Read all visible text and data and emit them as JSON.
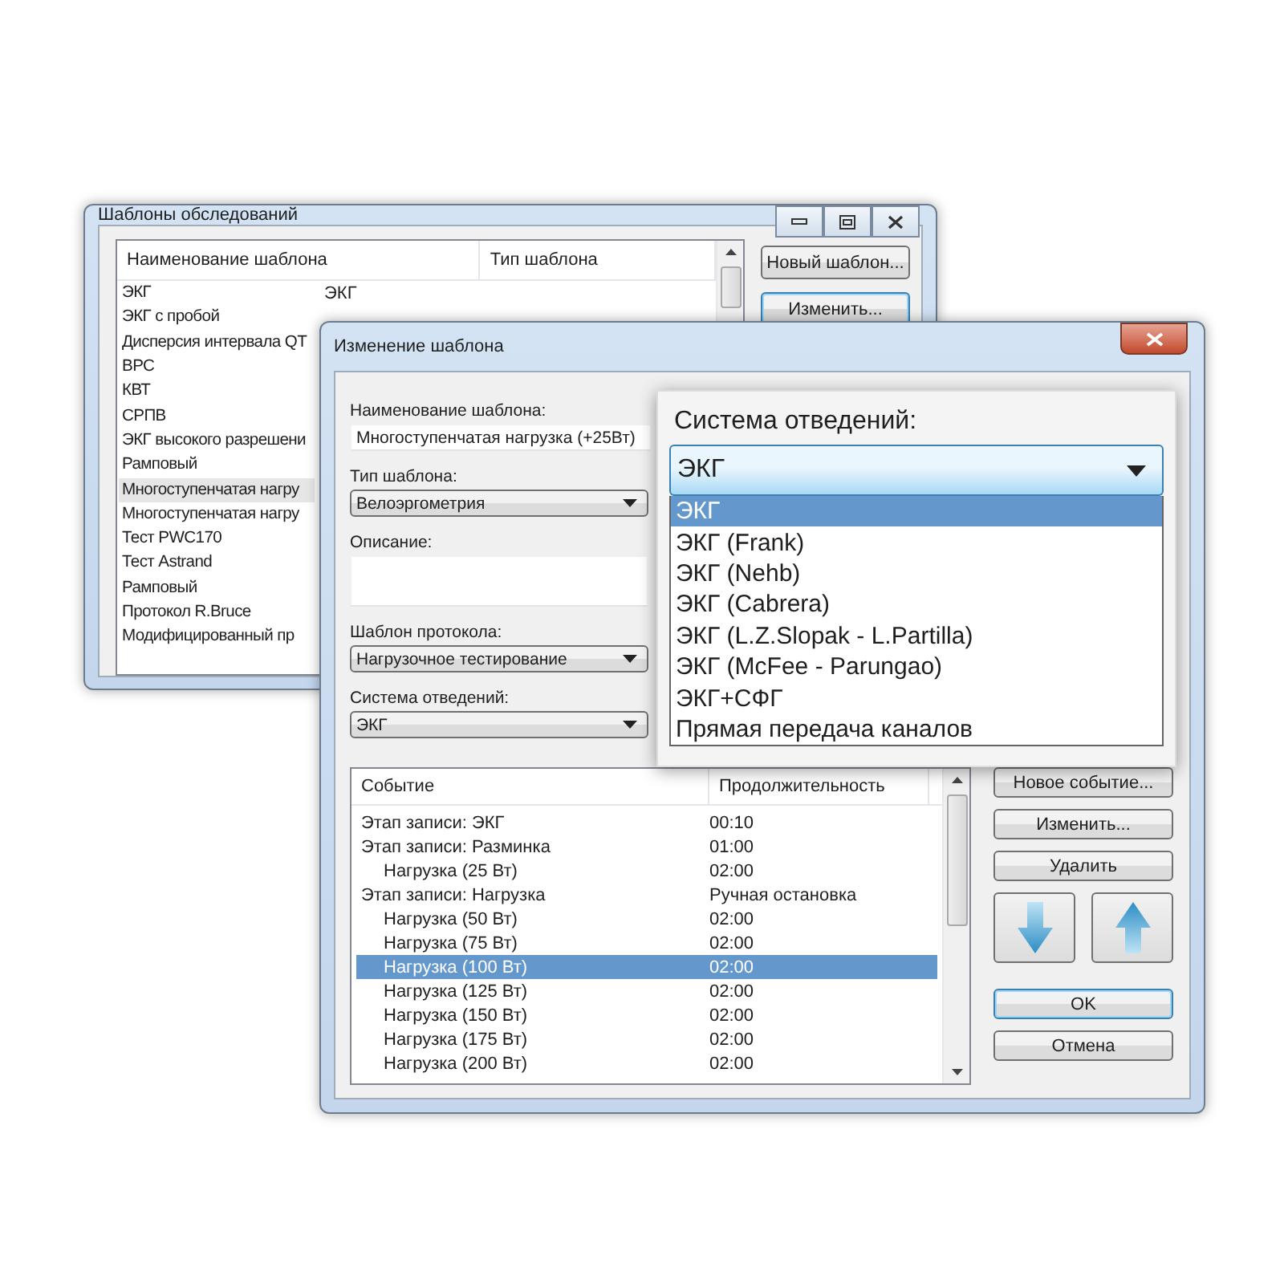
{
  "back_window": {
    "title": "Шаблоны обследований",
    "table": {
      "columns": [
        "Наименование шаблона",
        "Тип шаблона"
      ],
      "rows": [
        {
          "name": "ЭКГ",
          "type": "ЭКГ",
          "selected": false
        },
        {
          "name": "ЭКГ с пробой",
          "selected": false
        },
        {
          "name": "Дисперсия интервала QT",
          "selected": false
        },
        {
          "name": "ВРС",
          "selected": false
        },
        {
          "name": "КВТ",
          "selected": false
        },
        {
          "name": "СРПВ",
          "selected": false
        },
        {
          "name": "ЭКГ высокого разрешени",
          "selected": false
        },
        {
          "name": "Рамповый",
          "selected": false
        },
        {
          "name": "Многоступенчатая нагру",
          "selected": true
        },
        {
          "name": "Многоступенчатая нагру",
          "selected": false
        },
        {
          "name": "Тест PWC170",
          "selected": false
        },
        {
          "name": "Тест Astrand",
          "selected": false
        },
        {
          "name": "Рамповый",
          "selected": false
        },
        {
          "name": "Протокол R.Bruce",
          "selected": false
        },
        {
          "name": "Модифицированный пр",
          "selected": false
        }
      ]
    },
    "buttons": [
      "Новый шаблон...",
      "Изменить..."
    ]
  },
  "dialog": {
    "title": "Изменение шаблона",
    "fields": [
      {
        "kind": "text",
        "label": "Наименование шаблона:",
        "value": "Многоступенчатая нагрузка (+25Вт)"
      },
      {
        "kind": "select",
        "label": "Тип шаблона:",
        "value": "Велоэргометрия"
      },
      {
        "kind": "textarea",
        "label": "Описание:"
      },
      {
        "kind": "select",
        "label": "Шаблон протокола:",
        "value": "Нагрузочное тестирование"
      },
      {
        "kind": "select",
        "label": "Система отведений:",
        "value": "ЭКГ"
      }
    ],
    "events": {
      "columns": [
        "Событие",
        "Продолжительность"
      ],
      "rows": [
        {
          "event": "Этап записи: ЭКГ",
          "duration": "00:10",
          "selected": false
        },
        {
          "event": "Этап записи: Разминка",
          "duration": "01:00",
          "selected": false,
          "children": [
            {
              "event": "Нагрузка (25 Вт)",
              "duration": "02:00",
              "selected": false
            }
          ]
        },
        {
          "event": "Этап записи: Нагрузка",
          "duration": "Ручная остановка",
          "selected": false,
          "children": [
            {
              "event": "Нагрузка (50 Вт)",
              "duration": "02:00",
              "selected": false
            },
            {
              "event": "Нагрузка (75 Вт)",
              "duration": "02:00",
              "selected": false
            },
            {
              "event": "Нагрузка (100 Вт)",
              "duration": "02:00",
              "selected": true
            },
            {
              "event": "Нагрузка (125 Вт)",
              "duration": "02:00",
              "selected": false
            },
            {
              "event": "Нагрузка (150 Вт)",
              "duration": "02:00",
              "selected": false
            },
            {
              "event": "Нагрузка (175 Вт)",
              "duration": "02:00",
              "selected": false
            },
            {
              "event": "Нагрузка (200 Вт)",
              "duration": "02:00",
              "selected": false
            }
          ]
        }
      ]
    },
    "event_buttons": [
      "Новое событие...",
      "Изменить...",
      "Удалить"
    ],
    "ok": "OK",
    "cancel": "Отмена"
  },
  "popup": {
    "label": "Система отведений:",
    "value": "ЭКГ",
    "options": [
      {
        "label": "ЭКГ",
        "selected": true
      },
      {
        "label": "ЭКГ (Frank)",
        "selected": false
      },
      {
        "label": "ЭКГ (Nehb)",
        "selected": false
      },
      {
        "label": "ЭКГ (Cabrera)",
        "selected": false
      },
      {
        "label": "ЭКГ (L.Z.Slopak - L.Partilla)",
        "selected": false
      },
      {
        "label": "ЭКГ (McFee - Parungao)",
        "selected": false
      },
      {
        "label": "ЭКГ+СФГ",
        "selected": false
      },
      {
        "label": "Прямая передача каналов",
        "selected": false
      }
    ]
  }
}
